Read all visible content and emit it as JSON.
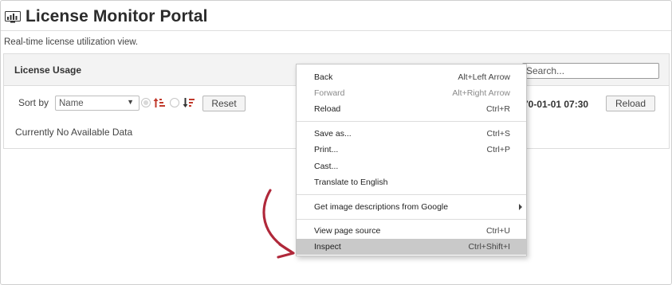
{
  "header": {
    "title": "License Monitor Portal",
    "subtitle": "Real-time license utilization view.",
    "icon": "monitor-chart-icon"
  },
  "panel": {
    "title": "License Usage",
    "search_placeholder": "Search..."
  },
  "toolbar": {
    "sort_label": "Sort by",
    "sort_selected": "Name",
    "sort_icon_ascending": "sort-ascending-icon",
    "sort_icon_descending": "sort-descending-icon",
    "reset_label": "Reset",
    "timestamp": "70-01-01 07:30",
    "reload_label": "Reload"
  },
  "empty_message": "Currently No Available Data",
  "context_menu": {
    "items": [
      {
        "label": "Back",
        "shortcut": "Alt+Left Arrow",
        "disabled": false
      },
      {
        "label": "Forward",
        "shortcut": "Alt+Right Arrow",
        "disabled": true
      },
      {
        "label": "Reload",
        "shortcut": "Ctrl+R",
        "disabled": false
      },
      {
        "label": "Save as...",
        "shortcut": "Ctrl+S",
        "disabled": false
      },
      {
        "label": "Print...",
        "shortcut": "Ctrl+P",
        "disabled": false
      },
      {
        "label": "Cast...",
        "shortcut": "",
        "disabled": false
      },
      {
        "label": "Translate to English",
        "shortcut": "",
        "disabled": false
      },
      {
        "label": "Get image descriptions from Google",
        "shortcut": "",
        "disabled": false,
        "submenu": true
      },
      {
        "label": "View page source",
        "shortcut": "Ctrl+U",
        "disabled": false
      },
      {
        "label": "Inspect",
        "shortcut": "Ctrl+Shift+I",
        "disabled": false,
        "highlighted": true
      }
    ]
  },
  "colors": {
    "accent_red": "#b0283a",
    "menu_highlight": "#c9c9c9",
    "sort_red": "#c0392b"
  }
}
